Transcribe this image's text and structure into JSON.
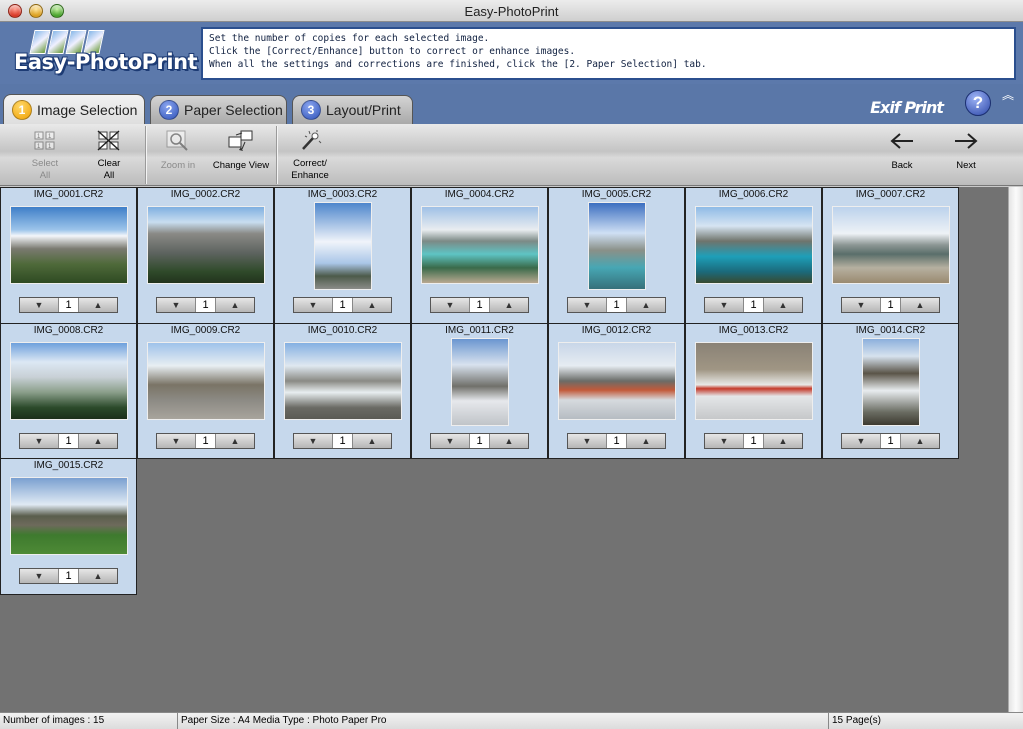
{
  "window": {
    "title": "Easy-PhotoPrint"
  },
  "header": {
    "logo_text": "Easy-PhotoPrint",
    "instructions": [
      "Set the number of copies for each selected image.",
      "Click the [Correct/Enhance] button to correct or enhance images.",
      "When all the settings and corrections are finished, click the [2. Paper Selection] tab."
    ]
  },
  "tabs": [
    {
      "number": "1",
      "label": "Image Selection",
      "active": true
    },
    {
      "number": "2",
      "label": "Paper Selection",
      "active": false
    },
    {
      "number": "3",
      "label": "Layout/Print",
      "active": false
    }
  ],
  "brand": {
    "exif_print": "Exif Print",
    "help": "?"
  },
  "toolbar": {
    "select_all": [
      "Select",
      "All"
    ],
    "clear_all": [
      "Clear",
      "All"
    ],
    "zoom_in": "Zoom in",
    "change_view": "Change View",
    "correct_enhance": [
      "Correct/",
      "Enhance"
    ],
    "back": "Back",
    "next": "Next"
  },
  "images": [
    {
      "name": "IMG_0001.CR2",
      "copies": "1",
      "orientation": "landscape"
    },
    {
      "name": "IMG_0002.CR2",
      "copies": "1",
      "orientation": "landscape"
    },
    {
      "name": "IMG_0003.CR2",
      "copies": "1",
      "orientation": "portrait"
    },
    {
      "name": "IMG_0004.CR2",
      "copies": "1",
      "orientation": "landscape"
    },
    {
      "name": "IMG_0005.CR2",
      "copies": "1",
      "orientation": "portrait"
    },
    {
      "name": "IMG_0006.CR2",
      "copies": "1",
      "orientation": "landscape"
    },
    {
      "name": "IMG_0007.CR2",
      "copies": "1",
      "orientation": "landscape"
    },
    {
      "name": "IMG_0008.CR2",
      "copies": "1",
      "orientation": "landscape"
    },
    {
      "name": "IMG_0009.CR2",
      "copies": "1",
      "orientation": "landscape"
    },
    {
      "name": "IMG_0010.CR2",
      "copies": "1",
      "orientation": "landscape"
    },
    {
      "name": "IMG_0011.CR2",
      "copies": "1",
      "orientation": "portrait"
    },
    {
      "name": "IMG_0012.CR2",
      "copies": "1",
      "orientation": "landscape"
    },
    {
      "name": "IMG_0013.CR2",
      "copies": "1",
      "orientation": "landscape"
    },
    {
      "name": "IMG_0014.CR2",
      "copies": "1",
      "orientation": "portrait"
    },
    {
      "name": "IMG_0015.CR2",
      "copies": "1",
      "orientation": "landscape"
    }
  ],
  "status": {
    "count": "Number of images : 15",
    "paper": "Paper Size : A4 Media Type : Photo Paper Pro",
    "pages": "15 Page(s)"
  },
  "colors": {
    "header_blue": "#5c79ab",
    "cell_blue": "#c6d8ec",
    "content_gray": "#727272"
  }
}
